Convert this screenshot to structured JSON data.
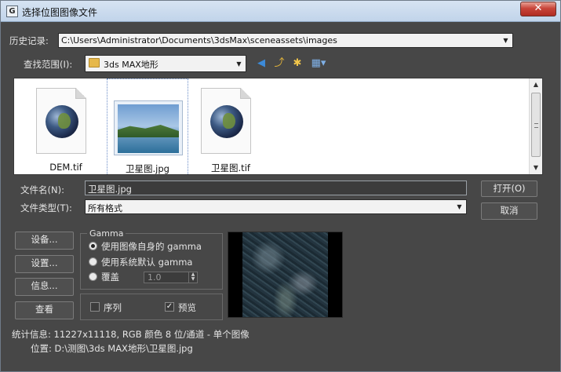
{
  "window": {
    "title": "选择位图图像文件",
    "close_label": "✕"
  },
  "history": {
    "label": "历史记录:",
    "value": "C:\\Users\\Administrator\\Documents\\3dsMax\\sceneassets\\images"
  },
  "lookin": {
    "label": "查找范围(I):",
    "value": "3ds MAX地形"
  },
  "files": [
    {
      "name": "DEM.tif",
      "type": "globe"
    },
    {
      "name": "卫星图.jpg",
      "type": "photo"
    },
    {
      "name": "卫星图.tif",
      "type": "globe"
    }
  ],
  "filename": {
    "label": "文件名(N):",
    "value": "卫星图.jpg"
  },
  "filetype": {
    "label": "文件类型(T):",
    "value": "所有格式"
  },
  "buttons": {
    "open": "打开(O)",
    "cancel": "取消",
    "device": "设备...",
    "setup": "设置...",
    "info": "信息...",
    "view": "查看"
  },
  "gamma": {
    "legend": "Gamma",
    "option_own": "使用图像自身的 gamma",
    "option_system": "使用系统默认 gamma",
    "option_override": "覆盖",
    "override_value": "1.0",
    "selected": "own"
  },
  "options": {
    "sequence_label": "序列",
    "sequence_checked": false,
    "preview_label": "预览",
    "preview_checked": true
  },
  "stats": {
    "info_line": "统计信息: 11227x11118, RGB 颜色 8 位/通道 - 单个图像",
    "location_line": "位置: D:\\测图\\3ds MAX地形\\卫星图.jpg"
  }
}
